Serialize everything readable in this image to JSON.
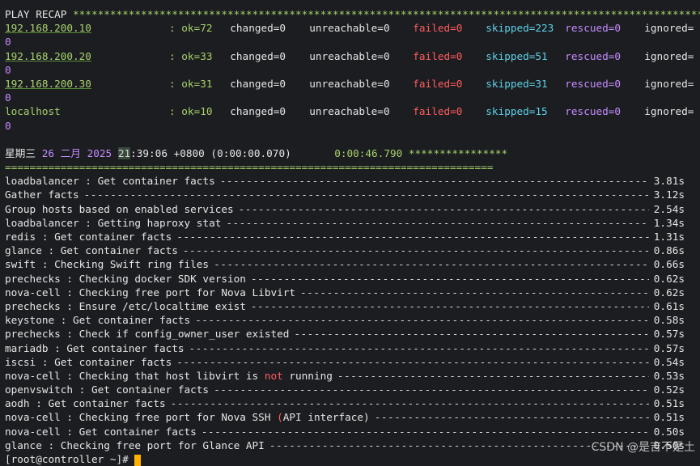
{
  "recap": {
    "title": "PLAY RECAP",
    "stars": "*******************************************************************************************************",
    "hosts": [
      {
        "name": "192.168.200.10",
        "ok": "ok=72",
        "changed": "changed=0",
        "unreachable": "unreachable=0",
        "failed": "failed=0",
        "skipped": "skipped=223",
        "rescued": "rescued=0",
        "ignored": "ignored=",
        "wrap": "0"
      },
      {
        "name": "192.168.200.20",
        "ok": "ok=33",
        "changed": "changed=0",
        "unreachable": "unreachable=0",
        "failed": "failed=0",
        "skipped": "skipped=51",
        "rescued": "rescued=0",
        "ignored": "ignored=",
        "wrap": "0"
      },
      {
        "name": "192.168.200.30",
        "ok": "ok=31",
        "changed": "changed=0",
        "unreachable": "unreachable=0",
        "failed": "failed=0",
        "skipped": "skipped=31",
        "rescued": "rescued=0",
        "ignored": "ignored=",
        "wrap": "0"
      },
      {
        "name": "localhost",
        "ok": "ok=10",
        "changed": "changed=0",
        "unreachable": "unreachable=0",
        "failed": "failed=0",
        "skipped": "skipped=15",
        "rescued": "rescued=0",
        "ignored": "ignored=",
        "wrap": "0"
      }
    ]
  },
  "timing": {
    "weekday": "星期三",
    "day": "26",
    "month": "二月",
    "year": "2025",
    "hour": "21",
    "rest_time": ":39:06 +0800 (0:00:00.070)",
    "elapsed": "0:00:46.790",
    "stars": "****************",
    "separator": "==============================================================================="
  },
  "tasks": [
    {
      "name": "loadbalancer : Get container facts",
      "time": "3.81s"
    },
    {
      "name": "Gather facts",
      "time": "3.12s"
    },
    {
      "name": "Group hosts based on enabled services",
      "time": "2.54s"
    },
    {
      "name": "loadbalancer : Getting haproxy stat",
      "time": "1.34s"
    },
    {
      "name": "redis : Get container facts",
      "time": "1.31s"
    },
    {
      "name": "glance : Get container facts",
      "time": "0.86s"
    },
    {
      "name": "swift : Checking Swift ring files",
      "time": "0.66s"
    },
    {
      "name": "prechecks : Checking docker SDK version",
      "time": "0.62s"
    },
    {
      "name": "nova-cell : Checking free port for Nova Libvirt",
      "time": "0.62s"
    },
    {
      "name": "prechecks : Ensure /etc/localtime exist",
      "time": "0.61s"
    },
    {
      "name": "keystone : Get container facts",
      "time": "0.58s"
    },
    {
      "name": "prechecks : Check if config_owner_user existed",
      "time": "0.57s"
    },
    {
      "name": "mariadb : Get container facts",
      "time": "0.57s"
    },
    {
      "name": "iscsi : Get container facts",
      "time": "0.54s"
    },
    {
      "name_pre": "nova-cell : Checking that host libvirt is ",
      "name_red": "not",
      "name_post": " running",
      "time": "0.53s"
    },
    {
      "name": "openvswitch : Get container facts",
      "time": "0.52s"
    },
    {
      "name": "aodh : Get container facts",
      "time": "0.51s"
    },
    {
      "name_pre": "nova-cell : Checking free port for Nova SSH ",
      "name_red": "(",
      "name_post": "API interface)",
      "time": "0.51s"
    },
    {
      "name": "nova-cell : Get container facts",
      "time": "0.50s"
    },
    {
      "name": "glance : Checking free port for Glance API",
      "time": "0.50s"
    }
  ],
  "prompt": "[root@controller ~]# ",
  "watermark": "CSDN @是吉不是土"
}
